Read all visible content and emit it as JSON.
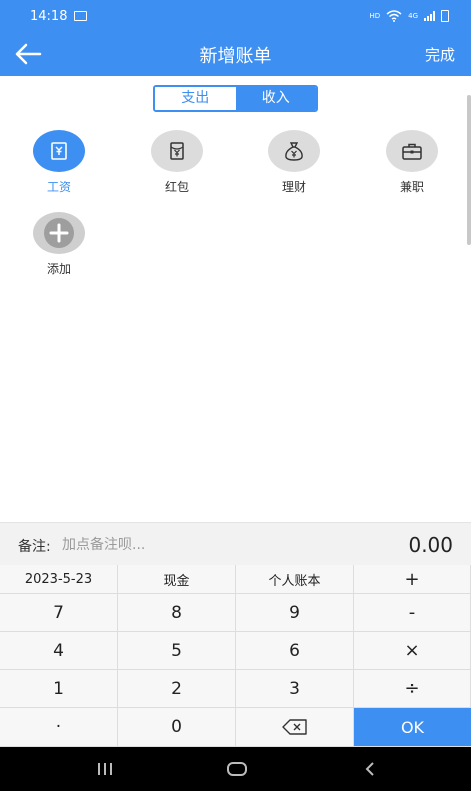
{
  "status": {
    "time": "14:18",
    "hd": "HD",
    "net": "4G"
  },
  "header": {
    "title": "新增账单",
    "done": "完成"
  },
  "tabs": {
    "expense": "支出",
    "income": "收入"
  },
  "categories": [
    {
      "label": "工资",
      "icon": "wage-icon",
      "active": true
    },
    {
      "label": "红包",
      "icon": "red-envelope-icon",
      "active": false
    },
    {
      "label": "理财",
      "icon": "money-bag-icon",
      "active": false
    },
    {
      "label": "兼职",
      "icon": "briefcase-icon",
      "active": false
    },
    {
      "label": "添加",
      "icon": "plus-icon",
      "active": false
    }
  ],
  "note": {
    "label": "备注:",
    "placeholder": "加点备注呗...",
    "amount": "0.00"
  },
  "keypad": {
    "date": "2023-5-23",
    "account_type": "现金",
    "book": "个人账本",
    "plus": "+",
    "minus": "-",
    "times": "×",
    "divide": "÷",
    "dot": "·",
    "ok": "OK",
    "digits": [
      "7",
      "8",
      "9",
      "4",
      "5",
      "6",
      "1",
      "2",
      "3",
      "0"
    ]
  },
  "colors": {
    "accent": "#3d8ff2",
    "icon_bg": "#dcdcdc"
  }
}
